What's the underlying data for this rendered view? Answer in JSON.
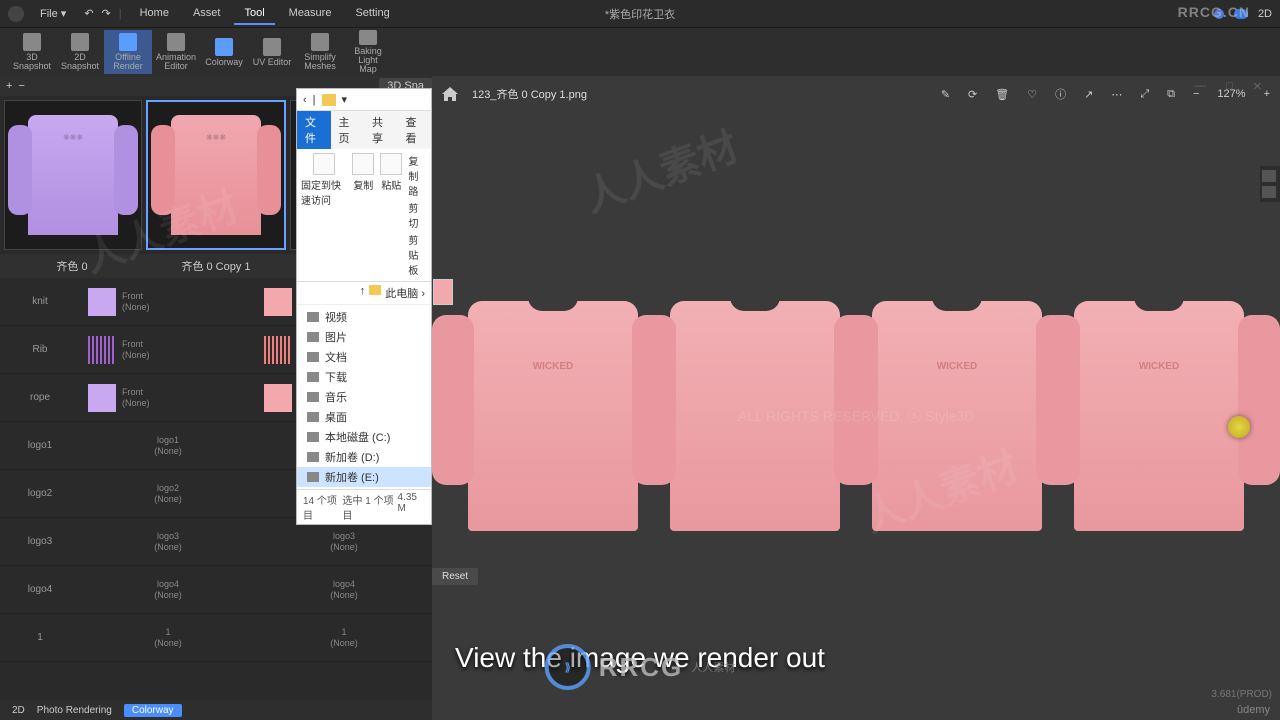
{
  "meta": {
    "watermark_brand": "RRCG.CN",
    "watermark_cn": "人人素材"
  },
  "topbar": {
    "file": "File ▾",
    "menu": [
      "Home",
      "Asset",
      "Tool",
      "Measure",
      "Setting"
    ],
    "active": "Tool",
    "title": "*紫色印花卫衣",
    "mode": "2D"
  },
  "toolbar": [
    {
      "label": "3D\nSnapshot"
    },
    {
      "label": "2D\nSnapshot"
    },
    {
      "label": "Offline\nRender",
      "active": true,
      "blue": true
    },
    {
      "label": "Animation\nEditor"
    },
    {
      "label": "Colorway",
      "blue": true
    },
    {
      "label": "UV Editor"
    },
    {
      "label": "Simplify\nMeshes"
    },
    {
      "label": "Baking Light\nMap"
    }
  ],
  "panel": {
    "snap": "3D Sna",
    "plus": "+",
    "minus": "−",
    "colorways": [
      {
        "name": "齐色 0",
        "color": "purple"
      },
      {
        "name": "齐色 0 Copy 1",
        "color": "pink",
        "selected": true
      }
    ],
    "rows": [
      {
        "label": "knit",
        "front": "Front",
        "none": "(None)",
        "c1": "#c8a8f0",
        "c2": "#f2a8ac"
      },
      {
        "label": "Rib",
        "front": "Front",
        "none": "(None)",
        "c1": "#a060d0",
        "c2": "#f08080",
        "stripe": true
      },
      {
        "label": "rope",
        "front": "Front",
        "none": "(None)",
        "c1": "#c8a8f0",
        "c2": "#f2a8ac"
      },
      {
        "label": "logo1",
        "front": "logo1",
        "none": "(None)",
        "dim": true
      },
      {
        "label": "logo2",
        "front": "logo2",
        "none": "(None)",
        "dim": true
      },
      {
        "label": "logo3",
        "front": "logo3",
        "none": "(None)",
        "dim": true
      },
      {
        "label": "logo4",
        "front": "logo4",
        "none": "(None)",
        "dim": true
      },
      {
        "label": "1",
        "front": "1",
        "none": "(None)",
        "dim": true
      }
    ],
    "footer": {
      "mode": "2D",
      "photo": "Photo Rendering",
      "colorway": "Colorway"
    }
  },
  "viewer": {
    "filename": "123_齐色 0 Copy 1.png",
    "zoom": "127%",
    "icons": [
      "✎",
      "⟳",
      "🗑",
      "♡",
      "ⓘ",
      "↗",
      "⋯",
      "⤢",
      "⧉",
      "−",
      "+"
    ],
    "wc": [
      "—",
      "□",
      "✕"
    ],
    "print": "WICKED",
    "watermark": "ALL RIGHTS RESERVED. ⓢ Style3D",
    "build": "3.681(PROD)",
    "udemy": "ûdemy"
  },
  "popup": {
    "tabs": [
      "文件",
      "主页",
      "共享",
      "查看"
    ],
    "active": "文件",
    "ribbon": {
      "pin": "固定到快\n速访问",
      "copy": "复制",
      "paste": "粘贴"
    },
    "clip": [
      "复制路",
      "剪切",
      "剪贴板"
    ],
    "breadcrumb": "此电脑 ›",
    "up": "↑",
    "items": [
      {
        "label": "视频"
      },
      {
        "label": "图片"
      },
      {
        "label": "文档"
      },
      {
        "label": "下载"
      },
      {
        "label": "音乐"
      },
      {
        "label": "桌面"
      },
      {
        "label": "本地磁盘 (C:)"
      },
      {
        "label": "新加卷 (D:)"
      },
      {
        "label": "新加卷 (E:)",
        "selected": true
      }
    ],
    "status": {
      "left": "14 个项目",
      "mid": "选中 1 个项目",
      "right": "4.35 M"
    }
  },
  "misc": {
    "reset": "Reset",
    "subtitle": "View the image we render out",
    "logo": "RRCG"
  }
}
